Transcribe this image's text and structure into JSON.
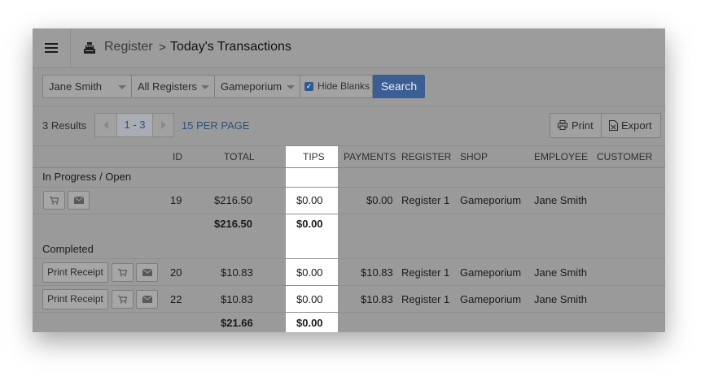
{
  "header": {
    "breadcrumb_parent": "Register",
    "separator": ">",
    "breadcrumb_current": "Today's Transactions"
  },
  "filters": {
    "employee": "Jane Smith",
    "register": "All Registers",
    "shop": "Gameporium",
    "hide_blanks_label": "Hide Blanks",
    "hide_blanks_checked": true,
    "search_label": "Search"
  },
  "toolbar": {
    "results": "3 Results",
    "page_range": "1 - 3",
    "per_page": "15 PER PAGE",
    "print_label": "Print",
    "export_label": "Export"
  },
  "table": {
    "columns": [
      "ID",
      "TOTAL",
      "TIPS",
      "PAYMENTS",
      "REGISTER",
      "SHOP",
      "EMPLOYEE",
      "CUSTOMER"
    ],
    "sections": [
      {
        "title": "In Progress / Open",
        "rows": [
          {
            "id": "19",
            "total": "$216.50",
            "tips": "$0.00",
            "payments": "$0.00",
            "register": "Register 1",
            "shop": "Gameporium",
            "employee": "Jane Smith",
            "customer": ""
          }
        ],
        "subtotal": {
          "total": "$216.50",
          "tips": "$0.00"
        }
      },
      {
        "title": "Completed",
        "rows": [
          {
            "receipt_label": "Print Receipt",
            "id": "20",
            "total": "$10.83",
            "tips": "$0.00",
            "payments": "$10.83",
            "register": "Register 1",
            "shop": "Gameporium",
            "employee": "Jane Smith",
            "customer": ""
          },
          {
            "receipt_label": "Print Receipt",
            "id": "22",
            "total": "$10.83",
            "tips": "$0.00",
            "payments": "$10.83",
            "register": "Register 1",
            "shop": "Gameporium",
            "employee": "Jane Smith",
            "customer": ""
          }
        ],
        "subtotal": {
          "total": "$21.66",
          "tips": "$0.00"
        }
      }
    ]
  },
  "colors": {
    "overlay": "#9a9a9a",
    "accent": "#3b5f95",
    "link": "#2f4f7a",
    "highlight_column": "#ffffff"
  },
  "icons": [
    "hamburger-icon",
    "register-icon",
    "chevron-left-icon",
    "chevron-right-icon",
    "printer-icon",
    "export-icon",
    "cart-icon",
    "envelope-icon"
  ]
}
